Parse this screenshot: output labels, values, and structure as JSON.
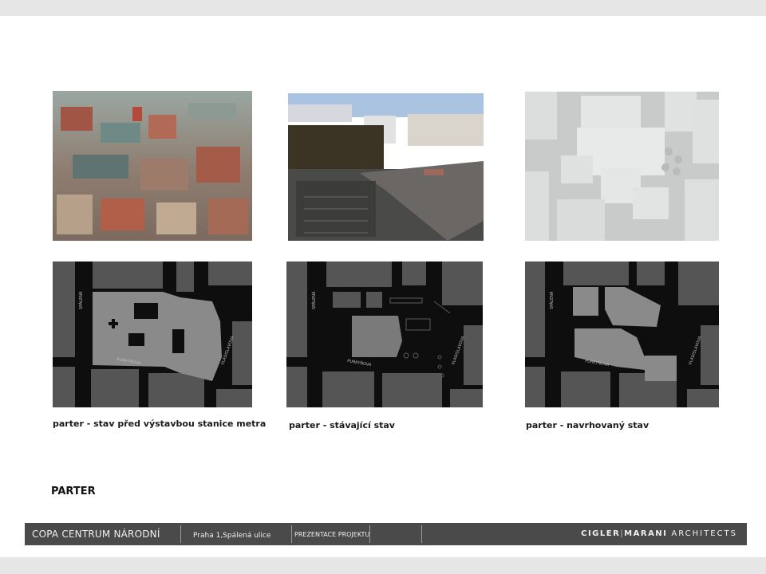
{
  "captions": {
    "before": "parter - stav před výstavbou stanice metra",
    "current": "parter - stávající stav",
    "proposed": "parter - navrhovaný stav"
  },
  "heading": "PARTER",
  "footer": {
    "project": "COPA CENTRUM NÁRODNÍ",
    "location": "Praha 1,Spálená ulice",
    "presentation": "PREZENTACE PROJEKTU",
    "logo_part1": "CIGLER",
    "logo_sep": "|",
    "logo_part2": "MARANI",
    "logo_part3": "ARCHITECTS"
  },
  "map_labels": {
    "spalena": "SPÁLENÁ",
    "purkynova": "PURKYŇOVA",
    "vladislavova": "VLADISLAVOVA"
  },
  "colors": {
    "page_bg": "#ffffff",
    "frame_bg": "#e6e6e6",
    "footer_bg": "#4a4a4a",
    "map_bg": "#0e0e0e",
    "map_block": "#555555",
    "map_highlight": "#8a8a8a"
  }
}
